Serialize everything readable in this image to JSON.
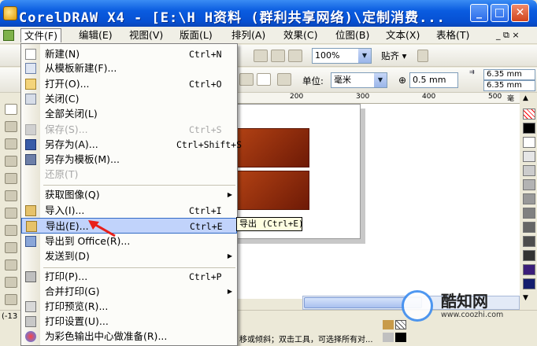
{
  "title_bar": {
    "title": "CorelDRAW X4 - [E:\\H  H资料 (群利共享网络)\\定制消费...",
    "minimize": "_",
    "maximize": "□",
    "close": "✕"
  },
  "menubar": {
    "items": [
      "文件(F)",
      "编辑(E)",
      "视图(V)",
      "版面(L)",
      "排列(A)",
      "效果(C)",
      "位图(B)",
      "文本(X)",
      "表格(T)"
    ],
    "doc_controls": "_ ⧉ ×"
  },
  "toolbar1": {
    "zoom": "100%",
    "snap": "贴齐"
  },
  "toolbar2": {
    "unit_label": "单位:",
    "unit_value": "毫米",
    "nudge": "0.5 mm",
    "dup_x": "6.35 mm",
    "dup_y": "6.35 mm"
  },
  "ruler": {
    "ticks": [
      "200",
      "300",
      "400",
      "500"
    ],
    "unit": "毫米"
  },
  "file_menu": {
    "items": [
      {
        "label": "新建(N)",
        "shortcut": "Ctrl+N",
        "disabled": false
      },
      {
        "label": "从模板新建(F)...",
        "shortcut": "",
        "disabled": false
      },
      {
        "label": "打开(O)...",
        "shortcut": "Ctrl+O",
        "disabled": false
      },
      {
        "label": "关闭(C)",
        "shortcut": "",
        "disabled": false
      },
      {
        "label": "全部关闭(L)",
        "shortcut": "",
        "disabled": false
      },
      {
        "label": "保存(S)...",
        "shortcut": "Ctrl+S",
        "disabled": true
      },
      {
        "label": "另存为(A)...",
        "shortcut": "Ctrl+Shift+S",
        "disabled": false
      },
      {
        "label": "另存为模板(M)...",
        "shortcut": "",
        "disabled": false
      },
      {
        "label": "还原(T)",
        "shortcut": "",
        "disabled": true
      },
      {
        "label": "获取图像(Q)",
        "shortcut": "",
        "disabled": false,
        "submenu": true
      },
      {
        "label": "导入(I)...",
        "shortcut": "Ctrl+I",
        "disabled": false
      },
      {
        "label": "导出(E)...",
        "shortcut": "Ctrl+E",
        "disabled": false,
        "highlighted": true
      },
      {
        "label": "导出到 Office(R)...",
        "shortcut": "",
        "disabled": false
      },
      {
        "label": "发送到(D)",
        "shortcut": "",
        "disabled": false,
        "submenu": true
      },
      {
        "label": "打印(P)...",
        "shortcut": "Ctrl+P",
        "disabled": false
      },
      {
        "label": "合并打印(G)",
        "shortcut": "",
        "disabled": false,
        "submenu": true
      },
      {
        "label": "打印预览(R)...",
        "shortcut": "",
        "disabled": false
      },
      {
        "label": "打印设置(U)...",
        "shortcut": "",
        "disabled": false
      },
      {
        "label": "为彩色输出中心做准备(R)...",
        "shortcut": "",
        "disabled": false
      }
    ]
  },
  "tooltip": "导出 (Ctrl+E)",
  "status": {
    "coords": "(-13",
    "hint": "移或倾斜；双击工具，可选择所有对..."
  },
  "watermark": {
    "brand": "酷知网",
    "url": "www.coozhi.com"
  },
  "colors": {
    "titlebar": "#0650d3",
    "highlight": "#c1d3fb",
    "arrow": "#e8201a"
  }
}
